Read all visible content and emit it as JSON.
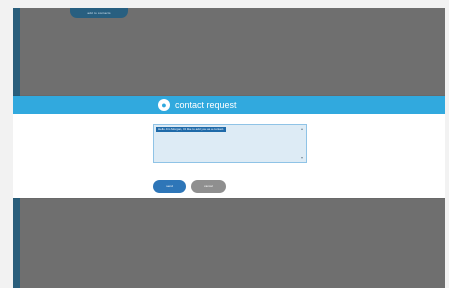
{
  "top_button_label": "add to contacts",
  "modal": {
    "title": "contact request",
    "icon": "person-icon",
    "message": "Hello Jim Morgan, I'd like to add you as a contact.",
    "send_label": "send",
    "cancel_label": "cancel"
  }
}
